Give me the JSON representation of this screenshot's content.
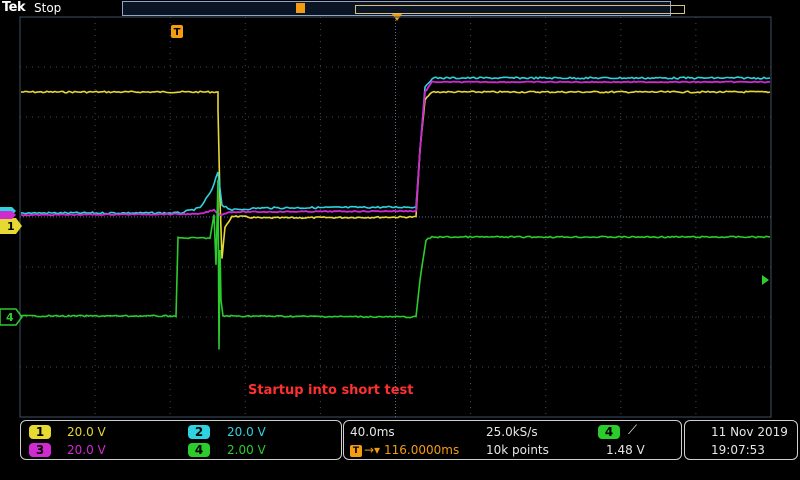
{
  "header": {
    "brand": "Tek",
    "run_state": "Stop",
    "trigger_marker_label": "T"
  },
  "colors": {
    "ch1": "#e6d932",
    "ch2": "#2fd3e0",
    "ch3": "#d02ad0",
    "ch4": "#2ccc2c",
    "grid": "#3a4f66",
    "trigger": "#f39c12",
    "annotation": "#ff3030"
  },
  "markers": {
    "ch1_ground": "1",
    "ch4_ground": "4"
  },
  "annotation": "Startup into short test",
  "channels": [
    {
      "id": "1",
      "scale": "20.0 V"
    },
    {
      "id": "2",
      "scale": "20.0 V"
    },
    {
      "id": "3",
      "scale": "20.0 V"
    },
    {
      "id": "4",
      "scale": "2.00 V"
    }
  ],
  "timebase": {
    "horizontal_scale": "40.0ms",
    "trigger_delay": "116.0000ms",
    "sample_rate": "25.0kS/s",
    "record_length": "10k points"
  },
  "trigger": {
    "source": "4",
    "slope_icon": "rising-edge-icon",
    "slope_symbol": "⟋",
    "level": "1.48 V"
  },
  "datetime": {
    "date": "11 Nov 2019",
    "time": "19:07:53"
  }
}
